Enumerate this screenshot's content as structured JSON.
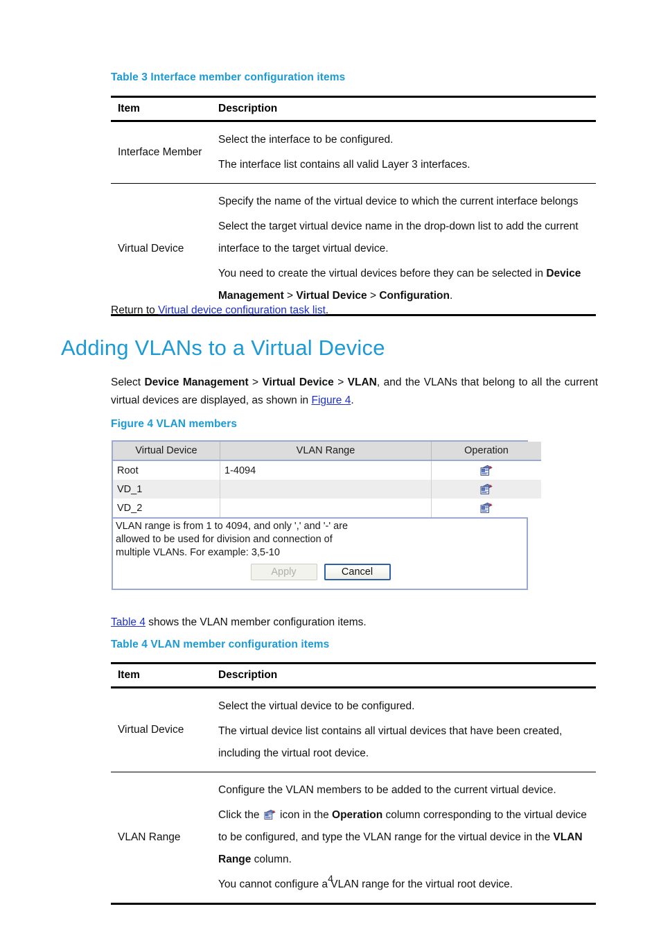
{
  "page": {
    "number": "4"
  },
  "table3": {
    "caption": "Table 3 Interface member configuration items",
    "headers": {
      "item": "Item",
      "description": "Description"
    },
    "rows": [
      {
        "item": "Interface Member",
        "paragraphs": [
          "Select the interface to be configured.",
          "The interface list contains all valid Layer 3 interfaces."
        ]
      },
      {
        "item": "Virtual Device",
        "paragraphs": [
          "Specify the name of the virtual device to which the current interface belongs",
          "Select the target virtual device name in the drop-down list to add the current interface to the target virtual device."
        ],
        "last_paragraph": {
          "prefix": "You need to create the virtual devices before they can be selected in ",
          "bold1": "Device Management",
          "sep1": " > ",
          "bold2": "Virtual Device",
          "sep2": " > ",
          "bold3": "Configuration",
          "suffix": "."
        }
      }
    ]
  },
  "return_line": {
    "prefix": "Return to ",
    "link": "Virtual device configuration task list",
    "suffix": "."
  },
  "heading": "Adding VLANs to a Virtual Device",
  "intro": {
    "prefix": "Select ",
    "bold1": "Device Management",
    "sep1": " > ",
    "bold2": "Virtual Device",
    "sep2": " > ",
    "bold3": "VLAN",
    "middle": ", and the VLANs that belong to all the current virtual devices are displayed, as shown in ",
    "link": "Figure 4",
    "suffix": "."
  },
  "figure4": {
    "caption": "Figure 4 VLAN members",
    "columns": [
      "Virtual Device",
      "VLAN Range",
      "Operation"
    ],
    "rows": [
      {
        "virtual_device": "Root",
        "vlan_range": "1-4094",
        "operation_icon": "edit-note-icon"
      },
      {
        "virtual_device": "VD_1",
        "vlan_range": "",
        "operation_icon": "edit-note-icon"
      },
      {
        "virtual_device": "VD_2",
        "vlan_range": "",
        "operation_icon": "edit-note-icon"
      }
    ],
    "note": "VLAN range is from 1 to 4094, and only ',' and '-' are\nallowed to be used for division and connection of\nmultiple VLANs. For example: 3,5-10",
    "buttons": {
      "apply": "Apply",
      "cancel": "Cancel"
    }
  },
  "table4_lead": {
    "link": "Table 4",
    "text": " shows the VLAN member configuration items."
  },
  "table4": {
    "caption": "Table 4 VLAN member configuration items",
    "headers": {
      "item": "Item",
      "description": "Description"
    },
    "rows": [
      {
        "item": "Virtual Device",
        "paragraphs": [
          "Select the virtual device to be configured.",
          "The virtual device list contains all virtual devices that have been created, including the virtual root device."
        ]
      },
      {
        "item": "VLAN Range",
        "first_paragraph": "Configure the VLAN members to be added to the current virtual device.",
        "icon_paragraph": {
          "prefix": "Click the ",
          "icon": "edit-note-icon",
          "middle1": " icon in the ",
          "bold1": "Operation",
          "middle2": " column corresponding to the virtual device to be configured, and type the VLAN range for the virtual device in the ",
          "bold2": "VLAN Range",
          "suffix": " column."
        },
        "last_paragraph": "You cannot configure a VLAN range for the virtual root device."
      }
    ]
  },
  "colors": {
    "accent_blue": "#1b9ad6",
    "link_blue": "#1c2fd0",
    "table_border": "#9aa9d4"
  }
}
